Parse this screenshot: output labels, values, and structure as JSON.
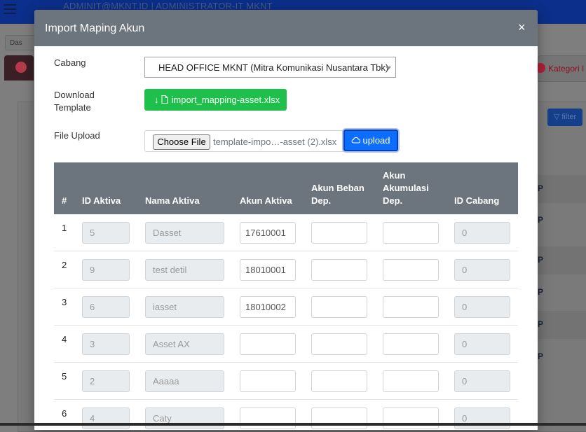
{
  "background": {
    "user_text": "ADMINIT@MKNT.ID | ADMINISTRATOR-IT MKNT",
    "crumb": "Das",
    "right_tab_label": "Kategori I",
    "filter_label": "filter",
    "row_marker": "P"
  },
  "modal": {
    "title": "Import Maping Akun",
    "close": "×",
    "cabang_label": "Cabang",
    "cabang_value": "HEAD OFFICE MKNT (Mitra Komunikasi Nusantara Tbk)",
    "download_label_line1": "Download",
    "download_label_line2": "Template",
    "download_button": "import_mapping-asset.xlsx",
    "file_upload_label": "File Upload",
    "choose_file": "Choose File",
    "file_name": "template-impo…-asset (2).xlsx",
    "upload_button": "upload"
  },
  "table": {
    "headers": {
      "no": "#",
      "id_aktiva": "ID Aktiva",
      "nama_aktiva": "Nama Aktiva",
      "akun_aktiva": "Akun Aktiva",
      "akun_beban_1": "Akun Beban",
      "akun_beban_2": "Dep.",
      "akun_akum_1": "Akun",
      "akun_akum_2": "Akumulasi",
      "akun_akum_3": "Dep.",
      "id_cabang": "ID Cabang"
    },
    "rows": [
      {
        "no": "1",
        "id": "5",
        "nama": "Dasset",
        "akun": "17610001",
        "beban": "",
        "akum": "",
        "cabang": "0"
      },
      {
        "no": "2",
        "id": "9",
        "nama": "test detil",
        "akun": "18010001",
        "beban": "",
        "akum": "",
        "cabang": "0"
      },
      {
        "no": "3",
        "id": "6",
        "nama": "iasset",
        "akun": "18010002",
        "beban": "",
        "akum": "",
        "cabang": "0"
      },
      {
        "no": "4",
        "id": "3",
        "nama": "Asset AX",
        "akun": "",
        "beban": "",
        "akum": "",
        "cabang": "0"
      },
      {
        "no": "5",
        "id": "2",
        "nama": "Aaaaa",
        "akun": "",
        "beban": "",
        "akum": "",
        "cabang": "0"
      },
      {
        "no": "6",
        "id": "4",
        "nama": "Caty",
        "akun": "",
        "beban": "",
        "akum": "",
        "cabang": "0"
      }
    ]
  },
  "icons": {
    "download": "download-arrow-icon",
    "file": "file-icon",
    "upload": "cloud-upload-icon",
    "filter": "filter-icon"
  }
}
